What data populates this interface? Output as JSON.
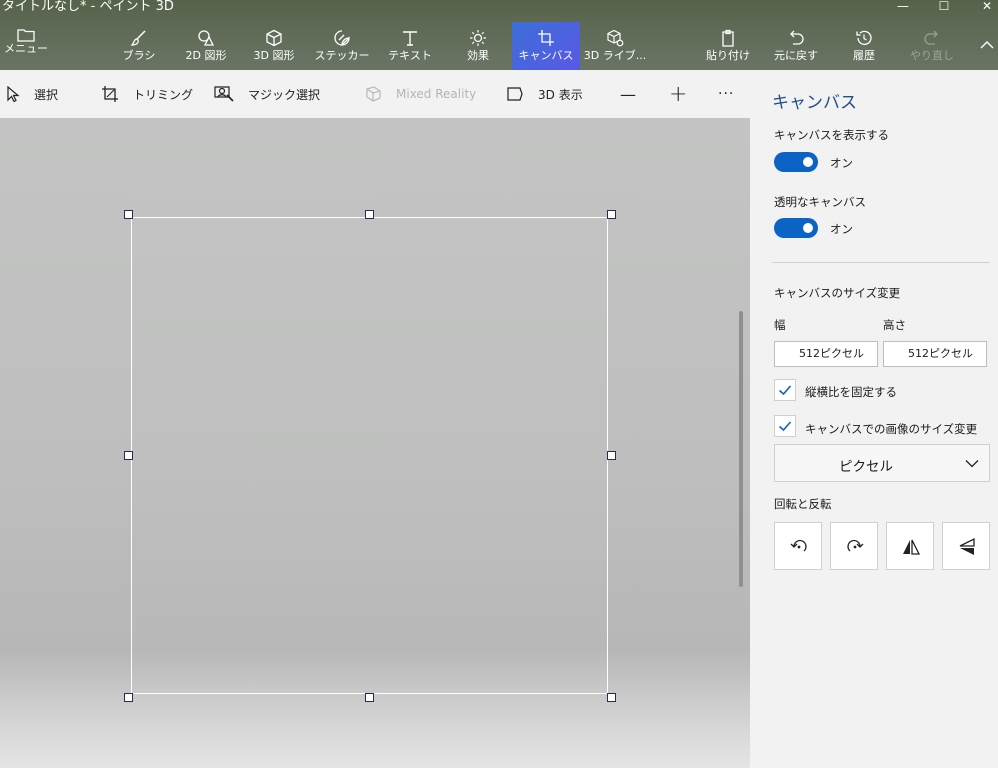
{
  "window": {
    "title": "タイトルなし* - ペイント 3D",
    "minimize_glyph": "—",
    "maximize_glyph": "☐",
    "close_glyph": "✕"
  },
  "ribbon": {
    "menu_label": "メニュー",
    "tools": [
      {
        "id": "brushes",
        "label": "ブラシ",
        "icon": "brush-icon"
      },
      {
        "id": "shapes2d",
        "label": "2D 図形",
        "icon": "2d-shapes-icon"
      },
      {
        "id": "shapes3d",
        "label": "3D 図形",
        "icon": "3d-shapes-icon"
      },
      {
        "id": "stickers",
        "label": "ステッカー",
        "icon": "sticker-icon"
      },
      {
        "id": "text",
        "label": "テキスト",
        "icon": "text-icon"
      },
      {
        "id": "effects",
        "label": "効果",
        "icon": "effects-icon"
      },
      {
        "id": "canvas",
        "label": "キャンバス",
        "icon": "canvas-icon",
        "active": true
      },
      {
        "id": "library3d",
        "label": "3D ライブ...",
        "icon": "3d-library-icon"
      }
    ],
    "actions": [
      {
        "id": "paste",
        "label": "貼り付け",
        "icon": "paste-icon"
      },
      {
        "id": "undo",
        "label": "元に戻す",
        "icon": "undo-icon"
      },
      {
        "id": "history",
        "label": "履歴",
        "icon": "history-icon"
      },
      {
        "id": "redo",
        "label": "やり直し",
        "icon": "redo-icon",
        "disabled": true
      }
    ]
  },
  "toolbar": {
    "select_label": "選択",
    "crop_label": "トリミング",
    "magic_select_label": "マジック選択",
    "mixed_reality_label": "Mixed Reality",
    "view3d_label": "3D 表示",
    "zoom_out_glyph": "—",
    "zoom_in_glyph": "+",
    "more_glyph": "···"
  },
  "panel": {
    "title": "キャンバス",
    "show_canvas": {
      "label": "キャンバスを表示する",
      "state": "オン",
      "on": true
    },
    "transparent_canvas": {
      "label": "透明なキャンバス",
      "state": "オン",
      "on": true
    },
    "resize_section": "キャンバスのサイズ変更",
    "width_label": "幅",
    "height_label": "高さ",
    "width_value": "512ピクセル",
    "height_value": "512ピクセル",
    "lock_aspect": {
      "label": "縦横比を固定する",
      "checked": true
    },
    "resize_image": {
      "label": "キャンバスでの画像のサイズ変更",
      "checked": true
    },
    "unit_dropdown": "ピクセル",
    "rotate_section": "回転と反転"
  },
  "colors": {
    "accent": "#0b63c5",
    "panel_title": "#1f4e8c",
    "active_tool": "#4a63e0"
  }
}
